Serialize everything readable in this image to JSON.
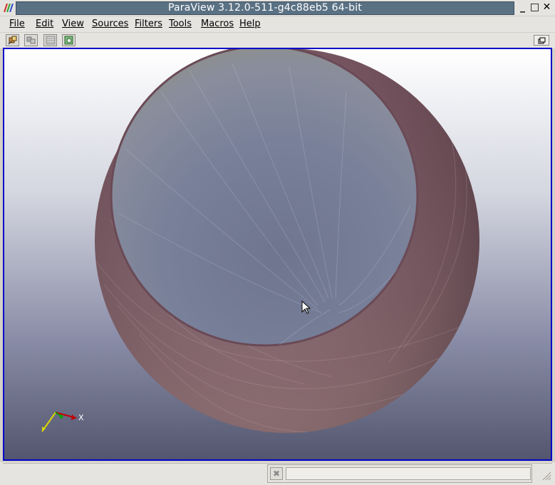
{
  "window": {
    "title": "ParaView 3.12.0-511-g4c88eb5 64-bit",
    "minimize": "_",
    "maximize": "□",
    "close": "✕"
  },
  "menu": [
    {
      "label": "File"
    },
    {
      "label": "Edit"
    },
    {
      "label": "View"
    },
    {
      "label": "Sources"
    },
    {
      "label": "Filters"
    },
    {
      "label": "Tools"
    },
    {
      "label": "Macros"
    },
    {
      "label": "Help"
    }
  ],
  "toolbar": {
    "buttons": [
      "split-view-icon",
      "multi-view-icon",
      "table-view-icon",
      "capture-screenshot-icon"
    ],
    "restore_icon": "restore-window-icon"
  },
  "render_view": {
    "background_top": "#ffffff",
    "background_bottom": "#53566e",
    "active_frame_color": "#0000c8",
    "orientation_axes": {
      "x_label": "X"
    },
    "surface": "sphere-surface-lic"
  },
  "statusbar": {
    "abort_label": "✖"
  }
}
